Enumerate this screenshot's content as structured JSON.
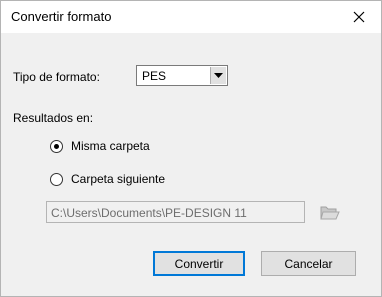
{
  "window": {
    "title": "Convertir formato"
  },
  "format": {
    "label": "Tipo de formato:",
    "selected": "PES"
  },
  "results": {
    "label": "Resultados en:",
    "options": [
      {
        "label": "Misma carpeta",
        "checked": true
      },
      {
        "label": "Carpeta siguiente",
        "checked": false
      }
    ],
    "folder_path": "C:\\Users\\Documents\\PE-DESIGN 11"
  },
  "buttons": {
    "convert": "Convertir",
    "cancel": "Cancelar"
  },
  "icons": {
    "close": "close-icon",
    "dropdown": "chevron-down-icon",
    "folder": "folder-open-icon"
  }
}
